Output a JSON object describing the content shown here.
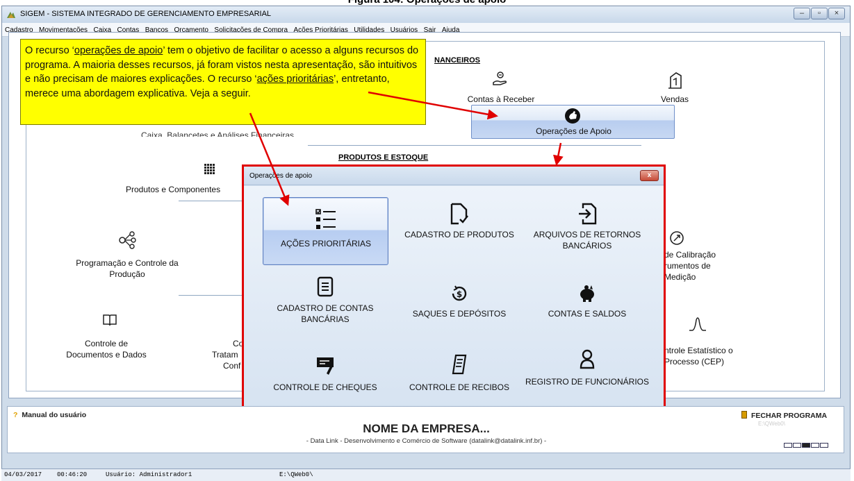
{
  "page_title": "Figura 104: Operações de apoio",
  "window": {
    "title": "SIGEM - SISTEMA INTEGRADO DE GERENCIAMENTO EMPRESARIAL",
    "controls": [
      "–",
      "▫",
      "×"
    ]
  },
  "menu": [
    "Cadastro",
    "Movimentações",
    "Caixa",
    "Contas",
    "Bancos",
    "Orçamento",
    "Solicitações de Compra",
    "Ações Prioritárias",
    "Utilidades",
    "Usuários",
    "Sair",
    "Ajuda"
  ],
  "callout": {
    "p1": "O recurso ‘",
    "link1": "operações de apoio",
    "p2": "’ tem o objetivo de facilitar o acesso a alguns recursos do programa. A maioria desses recursos, já foram vistos nesta apresentação, são intuitivos e não precisam de maiores explicações. O recurso ‘",
    "link2": "ações prioritárias",
    "p3": "’, entretanto, merece uma abordagem explicativa. Veja a seguir."
  },
  "background": {
    "financeiros_title": "NANCEIROS",
    "contas_receber": "Contas à Receber",
    "vendas": "Vendas",
    "caixa_partial": "Caixa, Balancetes e Análises Financeiras",
    "op_apoio": "Operações de Apoio",
    "produtos_estoque_title": "PRODUTOS E ESTOQUE",
    "produtos_componentes": "Produtos e Componentes",
    "programacao": "Programação e Controle da Produção",
    "calibracao": "de Calibração rumentos de Medição",
    "controle_documentos": "Controle de Documentos e Dados",
    "tratamento_partial_1": "Co",
    "tratamento_partial_2": "Tratam",
    "tratamento_partial_3": "Conf",
    "cep": "ntrole Estatístico o Processo (CEP)"
  },
  "dialog": {
    "title": "Operações de apoio",
    "close": "x",
    "tiles": [
      {
        "label": "AÇÕES PRIORITÁRIAS",
        "icon": "checklist-icon"
      },
      {
        "label": "CADASTRO DE PRODUTOS",
        "icon": "document-check-icon"
      },
      {
        "label": "ARQUIVOS DE RETORNOS BANCÁRIOS",
        "icon": "file-import-icon"
      },
      {
        "label": "CADASTRO DE CONTAS BANCÁRIAS",
        "icon": "list-document-icon"
      },
      {
        "label": "SAQUES E DEPÓSITOS",
        "icon": "money-cycle-icon"
      },
      {
        "label": "CONTAS E SALDOS",
        "icon": "piggy-bank-icon"
      },
      {
        "label": "CONTROLE DE CHEQUES",
        "icon": "cheque-icon"
      },
      {
        "label": "CONTROLE DE RECIBOS",
        "icon": "receipt-icon"
      },
      {
        "label": "REGISTRO DE FUNCIONÁRIOS",
        "icon": "person-icon"
      }
    ]
  },
  "bottom": {
    "manual": "Manual do usuário",
    "fechar": "FECHAR PROGRAMA",
    "path_faint": "E:\\QWeb0\\",
    "empresa": "NOME DA EMPRESA...",
    "datalink": "- Data Link - Desenvolvimento e Comércio de Software (datalink@datalink.inf.br) -"
  },
  "status": {
    "date": "04/03/2017",
    "time": "00:46:20",
    "user": "Usuário: Administrador1",
    "path": "E:\\QWeb0\\"
  }
}
